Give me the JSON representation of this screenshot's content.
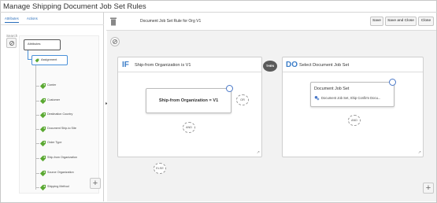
{
  "window": {
    "title": "Manage Shipping Document Job Set Rules"
  },
  "left_panel": {
    "tabs": [
      "Attributes",
      "Actions"
    ],
    "search_label": "Search",
    "tree": {
      "root": "Attributes",
      "group": "Assignment",
      "leaves": [
        "Carrier",
        "Customer",
        "Destination Country",
        "Document Ship-to Site",
        "Order Type",
        "Ship-from Organization",
        "Source Organization",
        "Shipping Method"
      ]
    }
  },
  "toolbar": {
    "rule_name": "Document Job Set Rule for Org V1",
    "save_label": "Save",
    "save_close_label": "Save and Close",
    "close_label": "Close"
  },
  "if_block": {
    "keyword": "IF",
    "heading": "Ship-from Organization is V1",
    "condition": "Ship-from Organization = V1",
    "or_label": "OR",
    "and_label": "AND",
    "else_label": "ELSE"
  },
  "then_label": "THEN",
  "do_block": {
    "keyword": "DO",
    "heading": "Select Document Job Set",
    "action_title": "Document Job Set",
    "action_value": "Document Job Set, Ship Confirm Docu...",
    "and_label": "AND"
  },
  "colors": {
    "accent": "#3b7dc8",
    "tag_green": "#5aa832",
    "then_badge": "#5a5a5a"
  }
}
